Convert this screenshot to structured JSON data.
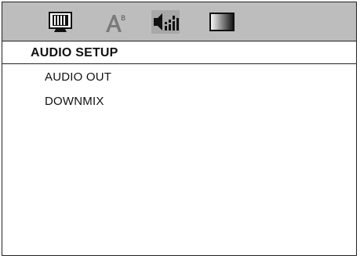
{
  "icons": [
    {
      "name": "tv-setup-icon"
    },
    {
      "name": "language-setup-icon"
    },
    {
      "name": "audio-setup-icon"
    },
    {
      "name": "video-setup-icon"
    }
  ],
  "header": {
    "title": "AUDIO SETUP"
  },
  "menu": {
    "items": [
      {
        "label": "AUDIO OUT"
      },
      {
        "label": "DOWNMIX"
      }
    ]
  },
  "colors": {
    "icon_bar_bg": "#bdbdbd",
    "border": "#222222",
    "text": "#111111",
    "background": "#ffffff"
  }
}
